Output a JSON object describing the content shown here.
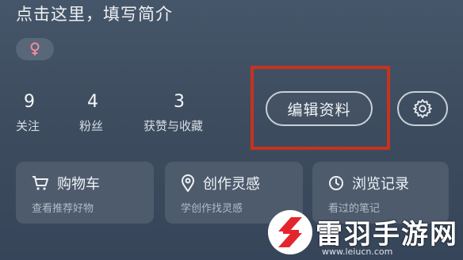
{
  "profile": {
    "bio_placeholder": "点击这里，填写简介"
  },
  "stats": [
    {
      "value": "9",
      "label": "关注"
    },
    {
      "value": "4",
      "label": "粉丝"
    },
    {
      "value": "3",
      "label": "获赞与收藏"
    }
  ],
  "actions": {
    "edit_label": "编辑资料",
    "settings_icon": "gear-icon"
  },
  "cards": [
    {
      "title": "购物车",
      "subtitle": "查看推荐好物",
      "icon": "cart-icon"
    },
    {
      "title": "创作灵感",
      "subtitle": "学创作找灵感",
      "icon": "location-pin-icon"
    },
    {
      "title": "浏览记录",
      "subtitle": "看过的笔记",
      "icon": "clock-icon"
    }
  ],
  "watermark": {
    "name": "雷羽手游网",
    "url": "www.leiucn.com"
  },
  "colors": {
    "background": "#3d4c5e",
    "highlight_border": "#c8321f",
    "card": "#4d5b6d",
    "gender_icon": "#f08a9a"
  }
}
